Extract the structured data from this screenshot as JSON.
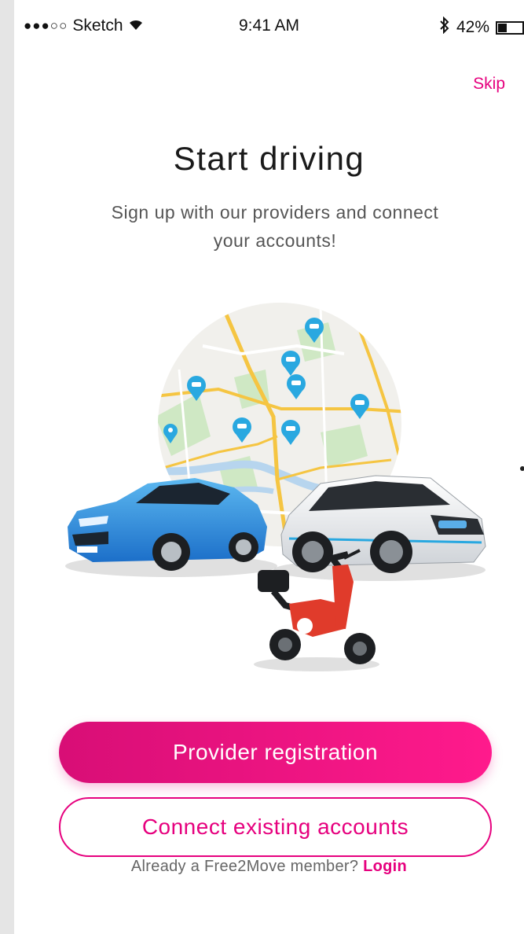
{
  "status_bar": {
    "signal": "●●●○○",
    "carrier": "Sketch",
    "wifi_icon": "wifi-icon",
    "time": "9:41 AM",
    "bluetooth_icon": "bluetooth-icon",
    "battery_percent": "42%",
    "battery_level": 0.42
  },
  "header": {
    "skip_label": "Skip"
  },
  "main": {
    "title": "Start driving",
    "subtitle": "Sign up with our providers and connect your accounts!"
  },
  "actions": {
    "primary_label": "Provider registration",
    "secondary_label": "Connect existing accounts"
  },
  "footer": {
    "prompt": "Already a Free2Move member?",
    "login_label": "Login"
  },
  "colors": {
    "accent": "#e6007e",
    "map_pin": "#29a8e0",
    "road": "#f5c542"
  }
}
